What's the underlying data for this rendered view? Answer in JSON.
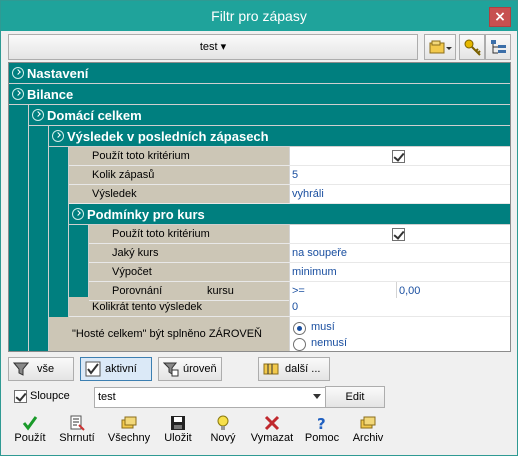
{
  "window": {
    "title": "Filtr pro zápasy",
    "close": "×"
  },
  "toolbar": {
    "preset": "test ▾"
  },
  "sections": {
    "nastaveni": "Nastavení",
    "bilance": "Bilance",
    "domaci": "Domácí celkem",
    "vysledek": "Výsledek v posledních zápasech",
    "podminky": "Podmínky pro kurs"
  },
  "rows": {
    "pouzit1": {
      "label": "Použít toto kritérium",
      "checked": true
    },
    "kolik": {
      "label": "Kolik zápasů",
      "value": "5"
    },
    "vysledek": {
      "label": "Výsledek",
      "value": "vyhráli"
    },
    "pouzit2": {
      "label": "Použít toto kritérium",
      "checked": true
    },
    "jaky": {
      "label": "Jaký kurs",
      "value": "na soupeře"
    },
    "vypocet": {
      "label": "Výpočet",
      "value": "minimum"
    },
    "porovnani": {
      "label": "Porovnání",
      "label2": "kursu",
      "op": ">=",
      "value": "0,00"
    },
    "kolikrat": {
      "label": "Kolikrát tento výsledek",
      "value": "0"
    },
    "hoste": {
      "label": "\"Hosté celkem\" být splněno ZÁROVEŇ",
      "opt1": "musí",
      "opt2": "nemusí"
    }
  },
  "viewbar": {
    "vse": "vše",
    "aktivni": "aktivní",
    "uroven": "úroveň",
    "dalsi": "další ..."
  },
  "columns": {
    "checkbox": "Sloupce",
    "selected": "test",
    "edit": "Edit"
  },
  "bottom": {
    "pouzit": "Použít",
    "shrnuti": "Shrnutí",
    "vsechny": "Všechny",
    "ulozit": "Uložit",
    "novy": "Nový",
    "vymazat": "Vymazat",
    "pomoc": "Pomoc",
    "archiv": "Archiv"
  },
  "colors": {
    "teal": "#007f7f",
    "titlebar": "#1fa39b",
    "value_text": "#1a4fa0"
  }
}
